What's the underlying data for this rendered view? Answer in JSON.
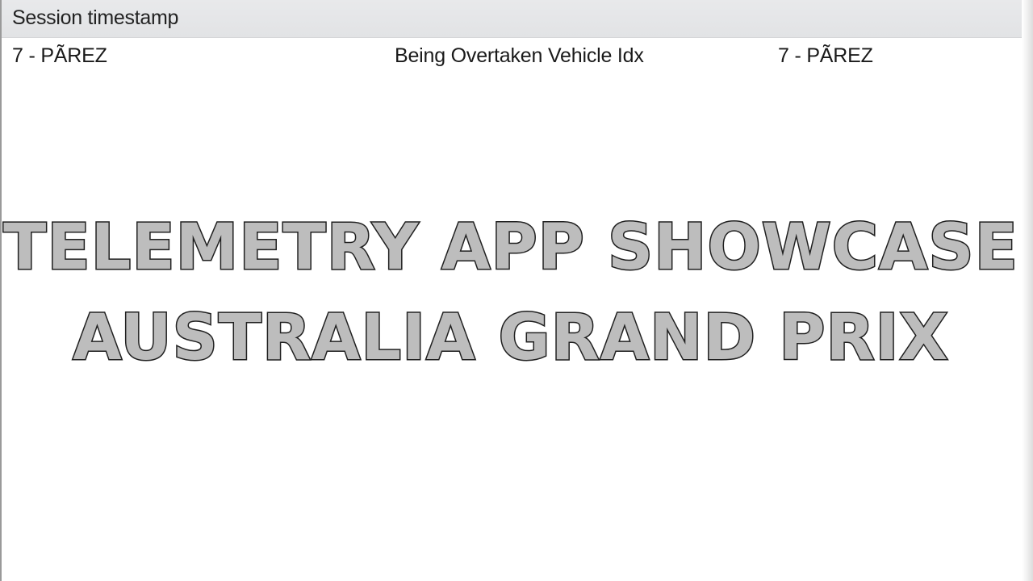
{
  "header": {
    "column_label": "Session timestamp"
  },
  "row": {
    "driver": "7 - PÃREZ",
    "label": "Being Overtaken Vehicle Idx",
    "value": "7 - PÃREZ"
  },
  "overlay": {
    "line1": "TELEMETRY APP SHOWCASE",
    "line2": "AUSTRALIA GRAND PRIX"
  }
}
